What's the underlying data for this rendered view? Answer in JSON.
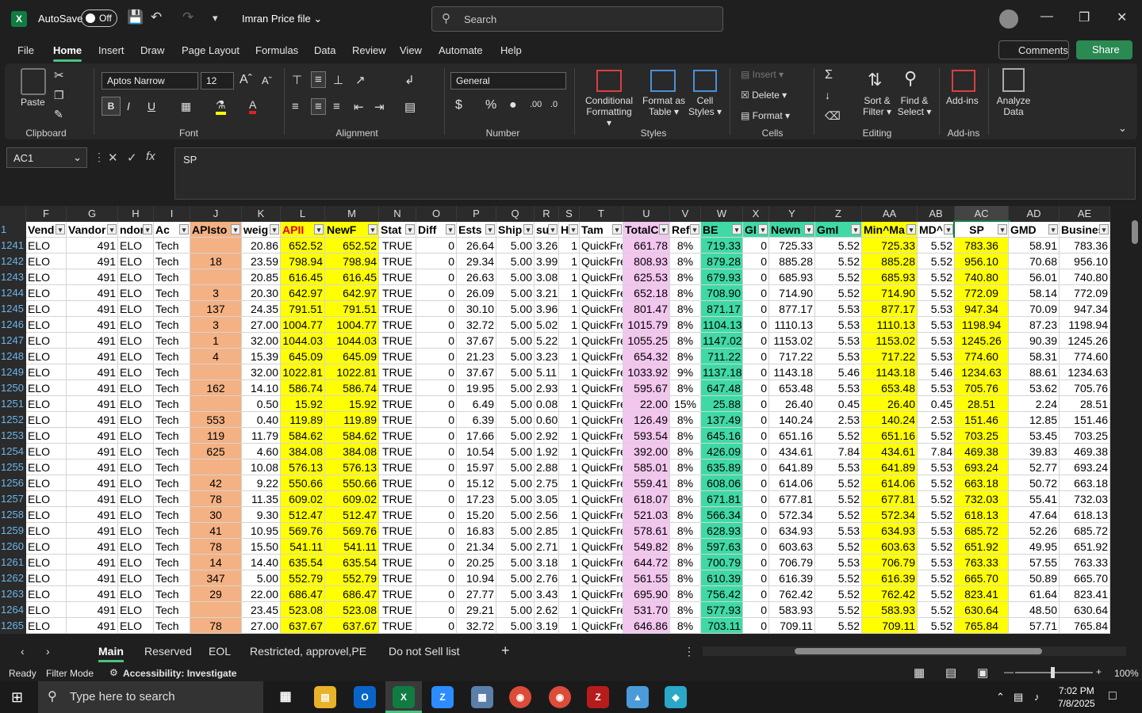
{
  "titlebar": {
    "autosave": "AutoSave",
    "toggle": "Off",
    "filename": "Imran Price file",
    "search": "Search"
  },
  "menu": [
    "File",
    "Home",
    "Insert",
    "Draw",
    "Page Layout",
    "Formulas",
    "Data",
    "Review",
    "View",
    "Automate",
    "Help"
  ],
  "actions": {
    "comments": "Comments",
    "share": "Share"
  },
  "ribbon": {
    "clipboard": "Clipboard",
    "paste": "Paste",
    "font_group": "Font",
    "font": "Aptos Narrow",
    "size": "12",
    "alignment": "Alignment",
    "number": "Number",
    "format": "General",
    "styles": "Styles",
    "conditional": "Conditional",
    "formatting": "Formatting",
    "format_as": "Format as",
    "table": "Table",
    "cell": "Cell",
    "cell_styles": "Styles",
    "cells": "Cells",
    "insert": "Insert",
    "delete": "Delete",
    "format_btn": "Format",
    "editing": "Editing",
    "sort": "Sort &",
    "filter": "Filter",
    "find": "Find &",
    "select": "Select",
    "addins_group": "Add-ins",
    "addins": "Add-ins",
    "analyze": "Analyze",
    "data": "Data"
  },
  "formula": {
    "namebox": "AC1",
    "value": "SP"
  },
  "columns": [
    "F",
    "G",
    "H",
    "I",
    "J",
    "K",
    "L",
    "M",
    "N",
    "O",
    "P",
    "Q",
    "R",
    "S",
    "T",
    "U",
    "V",
    "W",
    "X",
    "Y",
    "Z",
    "AA",
    "AB",
    "AC",
    "AD",
    "AE"
  ],
  "headers": [
    "Vend",
    "Vandor",
    "ndor",
    "Ac",
    "APIsto",
    "weig",
    "APII",
    "NewF",
    "Stat",
    "Diff",
    "Ests",
    "Ship",
    "sul",
    "H",
    "Tam",
    "TotalC",
    "Ref",
    "BE",
    "GI",
    "Newn",
    "GmI",
    "Min^Ma",
    "MD^",
    "SP",
    "GMD",
    "Busines"
  ],
  "rows": [
    {
      "n": "1241",
      "v": [
        "ELO",
        "491",
        "ELO",
        "Tech",
        "",
        "20.86",
        "652.52",
        "652.52",
        "TRUE",
        "0",
        "26.64",
        "5.00",
        "3.26",
        "1",
        "QuickFre",
        "661.78",
        "8%",
        "719.33",
        "0",
        "725.33",
        "5.52",
        "725.33",
        "5.52",
        "783.36",
        "58.91",
        "783.36"
      ]
    },
    {
      "n": "1242",
      "v": [
        "ELO",
        "491",
        "ELO",
        "Tech",
        "18",
        "23.59",
        "798.94",
        "798.94",
        "TRUE",
        "0",
        "29.34",
        "5.00",
        "3.99",
        "1",
        "QuickFre",
        "808.93",
        "8%",
        "879.28",
        "0",
        "885.28",
        "5.52",
        "885.28",
        "5.52",
        "956.10",
        "70.68",
        "956.10"
      ]
    },
    {
      "n": "1243",
      "v": [
        "ELO",
        "491",
        "ELO",
        "Tech",
        "",
        "20.85",
        "616.45",
        "616.45",
        "TRUE",
        "0",
        "26.63",
        "5.00",
        "3.08",
        "1",
        "QuickFre",
        "625.53",
        "8%",
        "679.93",
        "0",
        "685.93",
        "5.52",
        "685.93",
        "5.52",
        "740.80",
        "56.01",
        "740.80"
      ]
    },
    {
      "n": "1244",
      "v": [
        "ELO",
        "491",
        "ELO",
        "Tech",
        "3",
        "20.30",
        "642.97",
        "642.97",
        "TRUE",
        "0",
        "26.09",
        "5.00",
        "3.21",
        "1",
        "QuickFre",
        "652.18",
        "8%",
        "708.90",
        "0",
        "714.90",
        "5.52",
        "714.90",
        "5.52",
        "772.09",
        "58.14",
        "772.09"
      ]
    },
    {
      "n": "1245",
      "v": [
        "ELO",
        "491",
        "ELO",
        "Tech",
        "137",
        "24.35",
        "791.51",
        "791.51",
        "TRUE",
        "0",
        "30.10",
        "5.00",
        "3.96",
        "1",
        "QuickFre",
        "801.47",
        "8%",
        "871.17",
        "0",
        "877.17",
        "5.53",
        "877.17",
        "5.53",
        "947.34",
        "70.09",
        "947.34"
      ]
    },
    {
      "n": "1246",
      "v": [
        "ELO",
        "491",
        "ELO",
        "Tech",
        "3",
        "27.00",
        "1004.77",
        "1004.77",
        "TRUE",
        "0",
        "32.72",
        "5.00",
        "5.02",
        "1",
        "QuickFre",
        "1015.79",
        "8%",
        "1104.13",
        "0",
        "1110.13",
        "5.53",
        "1110.13",
        "5.53",
        "1198.94",
        "87.23",
        "1198.94"
      ]
    },
    {
      "n": "1247",
      "v": [
        "ELO",
        "491",
        "ELO",
        "Tech",
        "1",
        "32.00",
        "1044.03",
        "1044.03",
        "TRUE",
        "0",
        "37.67",
        "5.00",
        "5.22",
        "1",
        "QuickFre",
        "1055.25",
        "8%",
        "1147.02",
        "0",
        "1153.02",
        "5.53",
        "1153.02",
        "5.53",
        "1245.26",
        "90.39",
        "1245.26"
      ]
    },
    {
      "n": "1248",
      "v": [
        "ELO",
        "491",
        "ELO",
        "Tech",
        "4",
        "15.39",
        "645.09",
        "645.09",
        "TRUE",
        "0",
        "21.23",
        "5.00",
        "3.23",
        "1",
        "QuickFre",
        "654.32",
        "8%",
        "711.22",
        "0",
        "717.22",
        "5.53",
        "717.22",
        "5.53",
        "774.60",
        "58.31",
        "774.60"
      ]
    },
    {
      "n": "1249",
      "v": [
        "ELO",
        "491",
        "ELO",
        "Tech",
        "",
        "32.00",
        "1022.81",
        "1022.81",
        "TRUE",
        "0",
        "37.67",
        "5.00",
        "5.11",
        "1",
        "QuickFre",
        "1033.92",
        "9%",
        "1137.18",
        "0",
        "1143.18",
        "5.46",
        "1143.18",
        "5.46",
        "1234.63",
        "88.61",
        "1234.63"
      ]
    },
    {
      "n": "1250",
      "v": [
        "ELO",
        "491",
        "ELO",
        "Tech",
        "162",
        "14.10",
        "586.74",
        "586.74",
        "TRUE",
        "0",
        "19.95",
        "5.00",
        "2.93",
        "1",
        "QuickFre",
        "595.67",
        "8%",
        "647.48",
        "0",
        "653.48",
        "5.53",
        "653.48",
        "5.53",
        "705.76",
        "53.62",
        "705.76"
      ]
    },
    {
      "n": "1251",
      "v": [
        "ELO",
        "491",
        "ELO",
        "Tech",
        "",
        "0.50",
        "15.92",
        "15.92",
        "TRUE",
        "0",
        "6.49",
        "5.00",
        "0.08",
        "1",
        "QuickFre",
        "22.00",
        "15%",
        "25.88",
        "0",
        "26.40",
        "0.45",
        "26.40",
        "0.45",
        "28.51",
        "2.24",
        "28.51"
      ]
    },
    {
      "n": "1252",
      "v": [
        "ELO",
        "491",
        "ELO",
        "Tech",
        "553",
        "0.40",
        "119.89",
        "119.89",
        "TRUE",
        "0",
        "6.39",
        "5.00",
        "0.60",
        "1",
        "QuickFre",
        "126.49",
        "8%",
        "137.49",
        "0",
        "140.24",
        "2.53",
        "140.24",
        "2.53",
        "151.46",
        "12.85",
        "151.46"
      ]
    },
    {
      "n": "1253",
      "v": [
        "ELO",
        "491",
        "ELO",
        "Tech",
        "119",
        "11.79",
        "584.62",
        "584.62",
        "TRUE",
        "0",
        "17.66",
        "5.00",
        "2.92",
        "1",
        "QuickFre",
        "593.54",
        "8%",
        "645.16",
        "0",
        "651.16",
        "5.52",
        "651.16",
        "5.52",
        "703.25",
        "53.45",
        "703.25"
      ]
    },
    {
      "n": "1254",
      "v": [
        "ELO",
        "491",
        "ELO",
        "Tech",
        "625",
        "4.60",
        "384.08",
        "384.08",
        "TRUE",
        "0",
        "10.54",
        "5.00",
        "1.92",
        "1",
        "QuickFre",
        "392.00",
        "8%",
        "426.09",
        "0",
        "434.61",
        "7.84",
        "434.61",
        "7.84",
        "469.38",
        "39.83",
        "469.38"
      ]
    },
    {
      "n": "1255",
      "v": [
        "ELO",
        "491",
        "ELO",
        "Tech",
        "",
        "10.08",
        "576.13",
        "576.13",
        "TRUE",
        "0",
        "15.97",
        "5.00",
        "2.88",
        "1",
        "QuickFre",
        "585.01",
        "8%",
        "635.89",
        "0",
        "641.89",
        "5.53",
        "641.89",
        "5.53",
        "693.24",
        "52.77",
        "693.24"
      ]
    },
    {
      "n": "1256",
      "v": [
        "ELO",
        "491",
        "ELO",
        "Tech",
        "42",
        "9.22",
        "550.66",
        "550.66",
        "TRUE",
        "0",
        "15.12",
        "5.00",
        "2.75",
        "1",
        "QuickFre",
        "559.41",
        "8%",
        "608.06",
        "0",
        "614.06",
        "5.52",
        "614.06",
        "5.52",
        "663.18",
        "50.72",
        "663.18"
      ]
    },
    {
      "n": "1257",
      "v": [
        "ELO",
        "491",
        "ELO",
        "Tech",
        "78",
        "11.35",
        "609.02",
        "609.02",
        "TRUE",
        "0",
        "17.23",
        "5.00",
        "3.05",
        "1",
        "QuickFre",
        "618.07",
        "8%",
        "671.81",
        "0",
        "677.81",
        "5.52",
        "677.81",
        "5.52",
        "732.03",
        "55.41",
        "732.03"
      ]
    },
    {
      "n": "1258",
      "v": [
        "ELO",
        "491",
        "ELO",
        "Tech",
        "30",
        "9.30",
        "512.47",
        "512.47",
        "TRUE",
        "0",
        "15.20",
        "5.00",
        "2.56",
        "1",
        "QuickFre",
        "521.03",
        "8%",
        "566.34",
        "0",
        "572.34",
        "5.52",
        "572.34",
        "5.52",
        "618.13",
        "47.64",
        "618.13"
      ]
    },
    {
      "n": "1259",
      "v": [
        "ELO",
        "491",
        "ELO",
        "Tech",
        "41",
        "10.95",
        "569.76",
        "569.76",
        "TRUE",
        "0",
        "16.83",
        "5.00",
        "2.85",
        "1",
        "QuickFre",
        "578.61",
        "8%",
        "628.93",
        "0",
        "634.93",
        "5.53",
        "634.93",
        "5.53",
        "685.72",
        "52.26",
        "685.72"
      ]
    },
    {
      "n": "1260",
      "v": [
        "ELO",
        "491",
        "ELO",
        "Tech",
        "78",
        "15.50",
        "541.11",
        "541.11",
        "TRUE",
        "0",
        "21.34",
        "5.00",
        "2.71",
        "1",
        "QuickFre",
        "549.82",
        "8%",
        "597.63",
        "0",
        "603.63",
        "5.52",
        "603.63",
        "5.52",
        "651.92",
        "49.95",
        "651.92"
      ]
    },
    {
      "n": "1261",
      "v": [
        "ELO",
        "491",
        "ELO",
        "Tech",
        "14",
        "14.40",
        "635.54",
        "635.54",
        "TRUE",
        "0",
        "20.25",
        "5.00",
        "3.18",
        "1",
        "QuickFre",
        "644.72",
        "8%",
        "700.79",
        "0",
        "706.79",
        "5.53",
        "706.79",
        "5.53",
        "763.33",
        "57.55",
        "763.33"
      ]
    },
    {
      "n": "1262",
      "v": [
        "ELO",
        "491",
        "ELO",
        "Tech",
        "347",
        "5.00",
        "552.79",
        "552.79",
        "TRUE",
        "0",
        "10.94",
        "5.00",
        "2.76",
        "1",
        "QuickFre",
        "561.55",
        "8%",
        "610.39",
        "0",
        "616.39",
        "5.52",
        "616.39",
        "5.52",
        "665.70",
        "50.89",
        "665.70"
      ]
    },
    {
      "n": "1263",
      "v": [
        "ELO",
        "491",
        "ELO",
        "Tech",
        "29",
        "22.00",
        "686.47",
        "686.47",
        "TRUE",
        "0",
        "27.77",
        "5.00",
        "3.43",
        "1",
        "QuickFre",
        "695.90",
        "8%",
        "756.42",
        "0",
        "762.42",
        "5.52",
        "762.42",
        "5.52",
        "823.41",
        "61.64",
        "823.41"
      ]
    },
    {
      "n": "1264",
      "v": [
        "ELO",
        "491",
        "ELO",
        "Tech",
        "",
        "23.45",
        "523.08",
        "523.08",
        "TRUE",
        "0",
        "29.21",
        "5.00",
        "2.62",
        "1",
        "QuickFre",
        "531.70",
        "8%",
        "577.93",
        "0",
        "583.93",
        "5.52",
        "583.93",
        "5.52",
        "630.64",
        "48.50",
        "630.64"
      ]
    },
    {
      "n": "1265",
      "v": [
        "ELO",
        "491",
        "ELO",
        "Tech",
        "78",
        "27.00",
        "637.67",
        "637.67",
        "TRUE",
        "0",
        "32.72",
        "5.00",
        "3.19",
        "1",
        "QuickFre",
        "646.86",
        "8%",
        "703.11",
        "0",
        "709.11",
        "5.52",
        "709.11",
        "5.52",
        "765.84",
        "57.71",
        "765.84"
      ]
    }
  ],
  "sheets": [
    "Main",
    "Reserved",
    "EOL",
    "Restricted, approvel,PE",
    "Do not Sell list"
  ],
  "status": {
    "ready": "Ready",
    "filter": "Filter Mode",
    "accessibility": "Accessibility: Investigate",
    "zoom": "100%"
  },
  "taskbar": {
    "search": "Type here to search",
    "time": "7:02 PM",
    "date": "7/8/2025"
  },
  "colors": {
    "salmon": "#f4b183",
    "yellow": "#ffff00",
    "pink": "#f2c6ee",
    "teal": "#3fd9a6",
    "accent": "#4cc27f"
  }
}
